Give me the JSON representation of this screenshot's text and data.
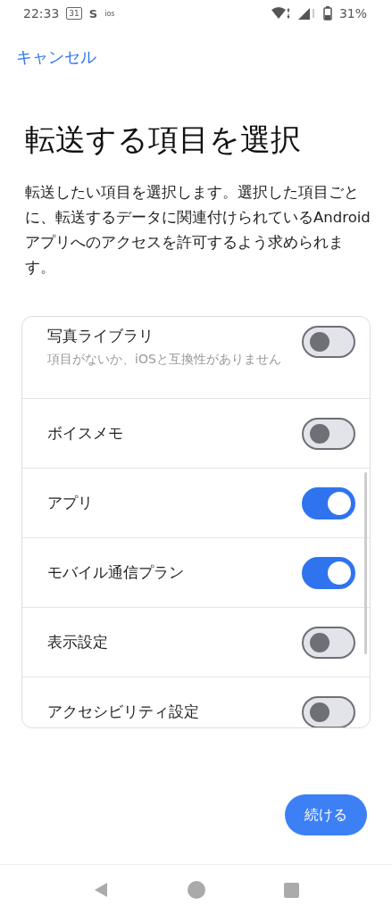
{
  "status_bar": {
    "time": "22:33",
    "calendar_day": "31",
    "app_letter": "S",
    "app_label": "ios",
    "battery": "31%"
  },
  "cancel": "キャンセル",
  "title": "転送する項目を選択",
  "description": "転送したい項目を選択します。選択した項目ごとに、転送するデータに関連付けられているAndroidアプリへのアクセスを許可するよう求められます。",
  "items": [
    {
      "label": "写真ライブラリ",
      "subtitle": "項目がないか、iOSと互換性がありません",
      "on": false
    },
    {
      "label": "ボイスメモ",
      "on": false
    },
    {
      "label": "アプリ",
      "on": true
    },
    {
      "label": "モバイル通信プラン",
      "on": true
    },
    {
      "label": "表示設定",
      "on": false
    },
    {
      "label": "アクセシビリティ設定",
      "on": false
    }
  ],
  "continue_button": "続ける"
}
